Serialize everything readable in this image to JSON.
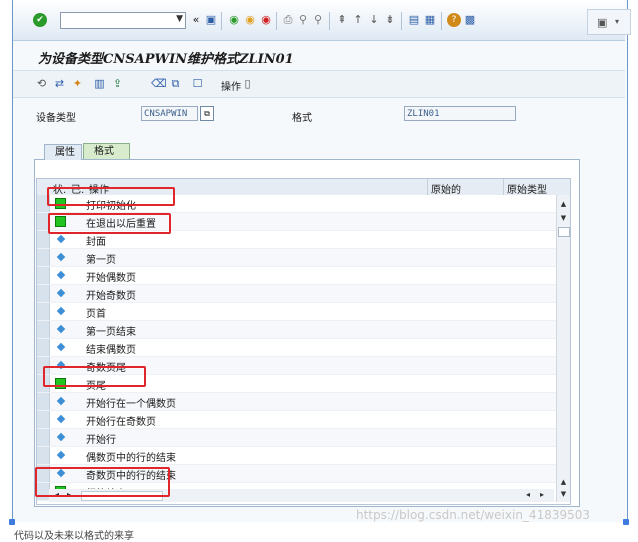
{
  "toolbar": {
    "command_value": "",
    "icons": [
      "check-icon",
      "back-icon",
      "save-icon",
      "back-nav-icon",
      "exit-icon",
      "cancel-icon",
      "print-icon",
      "find-icon",
      "find-next-icon",
      "first-page-icon",
      "prev-page-icon",
      "next-page-icon",
      "last-page-icon",
      "new-session-icon",
      "shortcut-icon",
      "help-icon",
      "layout-icon"
    ]
  },
  "page": {
    "title": "为设备类型CNSAPWIN维护格式ZLIN01"
  },
  "appbar": {
    "operation_label": "操作"
  },
  "fields": {
    "device_type_label": "设备类型",
    "device_type_value": "CNSAPWIN",
    "format_label": "格式",
    "format_value": "ZLIN01"
  },
  "tabs": {
    "attributes": "属性",
    "format": "格式"
  },
  "table": {
    "headers": {
      "status": "状.",
      "has": "已.",
      "operation": "操作",
      "original": "原始的",
      "original_type": "原始类型"
    },
    "rows": [
      {
        "status": "green",
        "label": "打印初始化"
      },
      {
        "status": "green",
        "label": "在退出以后重置"
      },
      {
        "status": "blue",
        "label": "封面"
      },
      {
        "status": "blue",
        "label": "第一页"
      },
      {
        "status": "blue",
        "label": "开始偶数页"
      },
      {
        "status": "blue",
        "label": "开始奇数页"
      },
      {
        "status": "blue",
        "label": "页首"
      },
      {
        "status": "blue",
        "label": "第一页结束"
      },
      {
        "status": "blue",
        "label": "结束偶数页"
      },
      {
        "status": "blue",
        "label": "奇数页尾"
      },
      {
        "status": "green",
        "label": "页尾"
      },
      {
        "status": "blue",
        "label": "开始行在一个偶数页"
      },
      {
        "status": "blue",
        "label": "开始行在奇数页"
      },
      {
        "status": "blue",
        "label": "开始行"
      },
      {
        "status": "blue",
        "label": "偶数页中的行的结束"
      },
      {
        "status": "blue",
        "label": "奇数页中的行的结束"
      },
      {
        "status": "green",
        "label": "行的结束"
      }
    ]
  },
  "colors": {
    "annotation_red": "#e0262a",
    "status_green": "#22c422",
    "status_blue": "#3d8fd6"
  },
  "watermark": "https://blog.csdn.net/weixin_41839503",
  "caption": "代码以及未来以格式的来享"
}
